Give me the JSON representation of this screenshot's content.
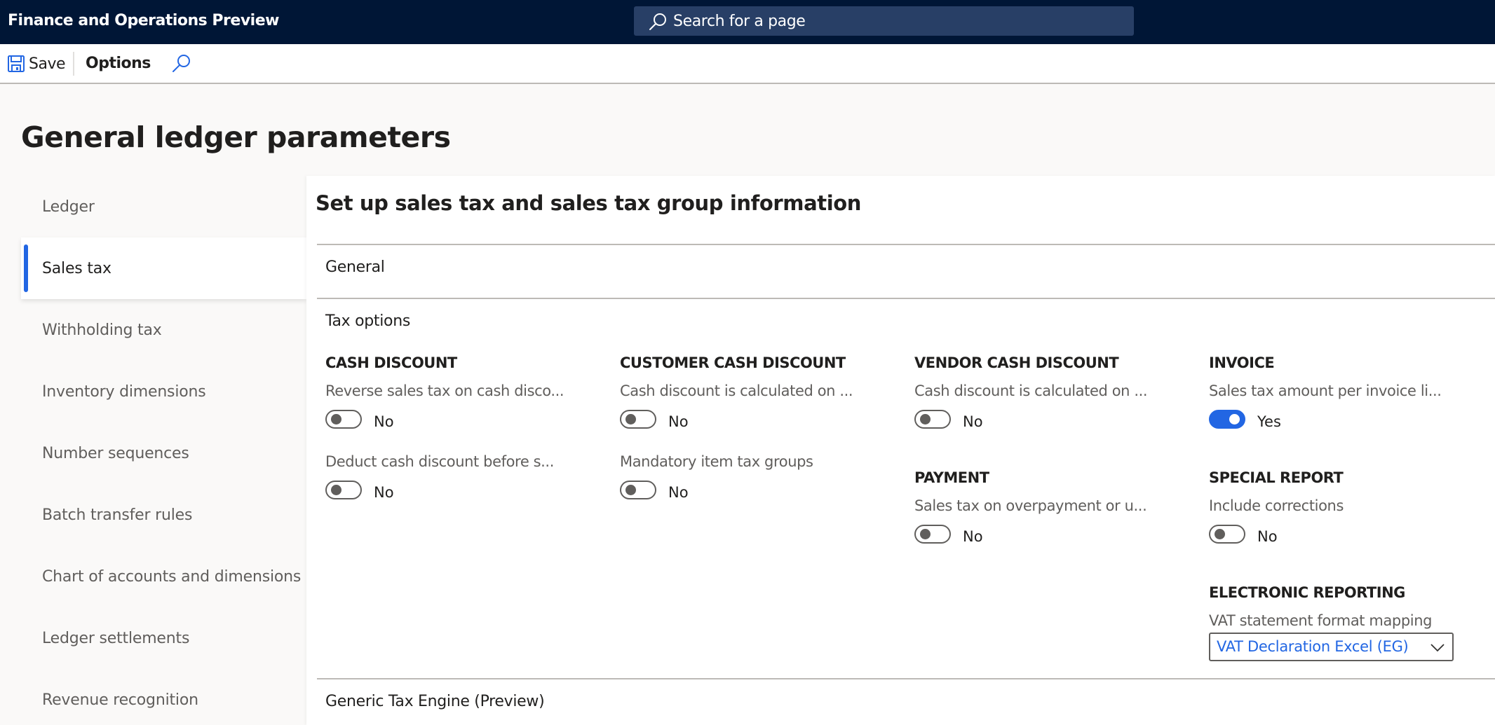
{
  "app": {
    "title": "Finance and Operations Preview",
    "search_placeholder": "Search for a page"
  },
  "toolbar": {
    "save_label": "Save",
    "options_label": "Options"
  },
  "page": {
    "title": "General ledger parameters"
  },
  "sidenav": {
    "items": [
      {
        "label": "Ledger",
        "active": false
      },
      {
        "label": "Sales tax",
        "active": true
      },
      {
        "label": "Withholding tax",
        "active": false
      },
      {
        "label": "Inventory dimensions",
        "active": false
      },
      {
        "label": "Number sequences",
        "active": false
      },
      {
        "label": "Batch transfer rules",
        "active": false
      },
      {
        "label": "Chart of accounts and dimensions",
        "active": false
      },
      {
        "label": "Ledger settlements",
        "active": false
      },
      {
        "label": "Revenue recognition",
        "active": false
      }
    ]
  },
  "main": {
    "title": "Set up sales tax and sales tax group information",
    "fasttabs": {
      "general": "General",
      "tax_options": "Tax options",
      "generic_tax_engine": "Generic Tax Engine (Preview)"
    },
    "columns": {
      "cash_discount": {
        "heading": "CASH DISCOUNT",
        "fields": [
          {
            "label": "Reverse sales tax on cash disco...",
            "value": "No",
            "on": false
          },
          {
            "label": "Deduct cash discount before s...",
            "value": "No",
            "on": false
          }
        ]
      },
      "customer_cash_discount": {
        "heading": "CUSTOMER CASH DISCOUNT",
        "fields": [
          {
            "label": "Cash discount is calculated on ...",
            "value": "No",
            "on": false
          },
          {
            "label": "Mandatory item tax groups",
            "value": "No",
            "on": false
          }
        ]
      },
      "vendor_cash_discount": {
        "heading": "VENDOR CASH DISCOUNT",
        "fields": [
          {
            "label": "Cash discount is calculated on ...",
            "value": "No",
            "on": false
          }
        ]
      },
      "payment": {
        "heading": "PAYMENT",
        "fields": [
          {
            "label": "Sales tax on overpayment or u...",
            "value": "No",
            "on": false
          }
        ]
      },
      "invoice": {
        "heading": "INVOICE",
        "fields": [
          {
            "label": "Sales tax amount per invoice li...",
            "value": "Yes",
            "on": true
          }
        ]
      },
      "special_report": {
        "heading": "SPECIAL REPORT",
        "fields": [
          {
            "label": "Include corrections",
            "value": "No",
            "on": false
          }
        ]
      },
      "electronic_reporting": {
        "heading": "ELECTRONIC REPORTING",
        "field_label": "VAT statement format mapping",
        "field_value": "VAT Declaration Excel (EG)"
      }
    }
  },
  "colors": {
    "header_bg": "#001636",
    "search_bg": "#283f66",
    "accent": "#2266e3"
  },
  "icons": {
    "save": "save-icon",
    "search": "search-icon",
    "chevron": "chevron-down-icon"
  }
}
